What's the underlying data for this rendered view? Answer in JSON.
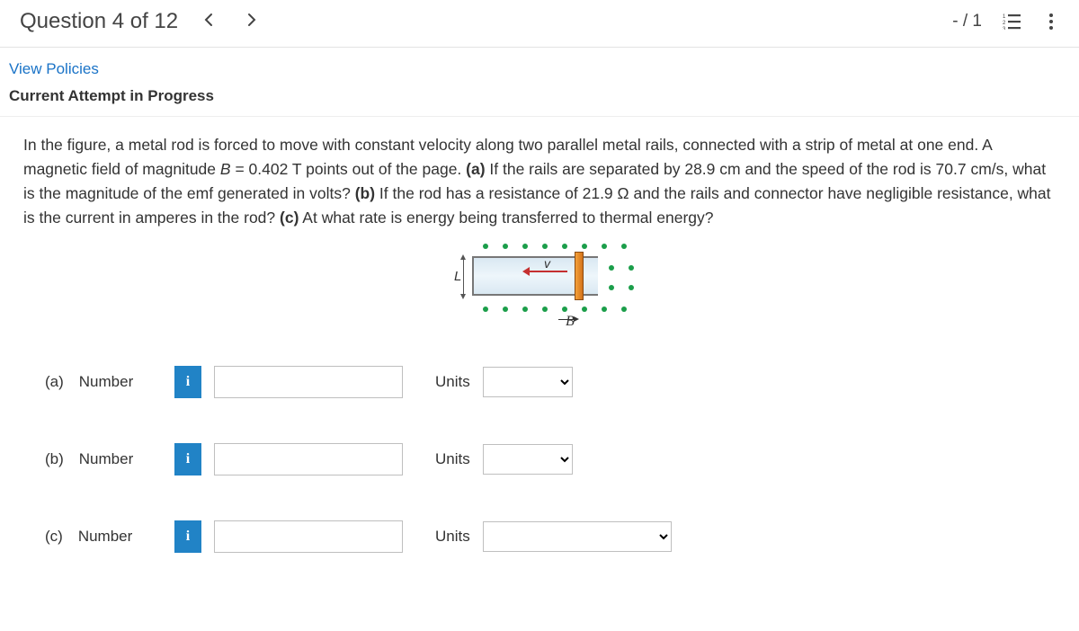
{
  "header": {
    "title": "Question 4 of 12",
    "score": "- / 1"
  },
  "links": {
    "policies": "View Policies",
    "attempt": "Current Attempt in Progress"
  },
  "problem": {
    "pre": "In the figure, a metal rod is forced to move with constant velocity along two parallel metal rails, connected with a strip of metal at one end. A magnetic field of magnitude ",
    "Bsym": "B",
    "Bval": " = 0.402 T points out of the page. ",
    "a_bold": "(a)",
    "a_text": " If the rails are separated by 28.9 cm and the speed of the rod is 70.7 cm/s, what is the magnitude of the emf generated in volts? ",
    "b_bold": "(b)",
    "b_text": " If the rod has a resistance of 21.9 Ω and the rails and connector have negligible resistance, what is the current in amperes in the rod? ",
    "c_bold": "(c)",
    "c_text": " At what rate is energy being transferred to thermal energy?"
  },
  "figure": {
    "L": "L",
    "v": "v",
    "B": "B"
  },
  "answers": {
    "a_label": "(a) Number",
    "b_label": "(b) Number",
    "c_label": "(c) Number",
    "units": "Units",
    "info": "i",
    "blank": " "
  }
}
